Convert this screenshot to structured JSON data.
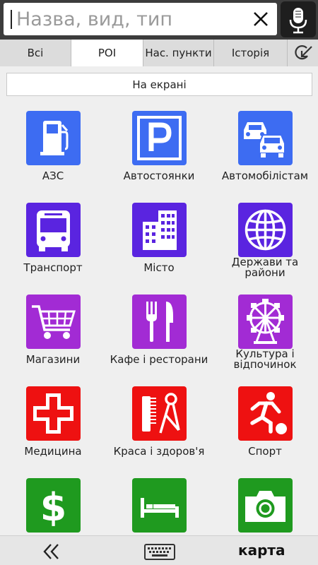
{
  "search": {
    "placeholder": "Назва, вид, тип",
    "value": ""
  },
  "tabs": [
    {
      "label": "Всі",
      "active": false
    },
    {
      "label": "POI",
      "active": true
    },
    {
      "label": "Нас. пункти",
      "active": false
    },
    {
      "label": "Історія",
      "active": false
    }
  ],
  "onscreen_label": "На екрані",
  "categories": [
    {
      "label": "АЗС",
      "icon": "fuel-icon",
      "color": "#3d6cf2"
    },
    {
      "label": "Автостоянки",
      "icon": "parking-icon",
      "color": "#3d6cf2"
    },
    {
      "label": "Автомобілістам",
      "icon": "cars-icon",
      "color": "#3d6cf2"
    },
    {
      "label": "Транспорт",
      "icon": "bus-icon",
      "color": "#5a24e0"
    },
    {
      "label": "Місто",
      "icon": "building-icon",
      "color": "#5a24e0"
    },
    {
      "label": "Держави та райони",
      "icon": "globe-icon",
      "color": "#5a24e0"
    },
    {
      "label": "Магазини",
      "icon": "cart-icon",
      "color": "#a22bd4"
    },
    {
      "label": "Кафе і ресторани",
      "icon": "cutlery-icon",
      "color": "#a22bd4"
    },
    {
      "label": "Культура і відпочинок",
      "icon": "ferris-wheel-icon",
      "color": "#a22bd4"
    },
    {
      "label": "Медицина",
      "icon": "medical-cross-icon",
      "color": "#ee1111"
    },
    {
      "label": "Краса і здоров'я",
      "icon": "comb-scissors-icon",
      "color": "#ee1111"
    },
    {
      "label": "Спорт",
      "icon": "soccer-icon",
      "color": "#ee1111"
    },
    {
      "label": "",
      "icon": "dollar-icon",
      "color": "#1f9a1f"
    },
    {
      "label": "",
      "icon": "bed-icon",
      "color": "#1f9a1f"
    },
    {
      "label": "",
      "icon": "camera-icon",
      "color": "#1f9a1f"
    }
  ],
  "bottom": {
    "map_label": "карта"
  }
}
